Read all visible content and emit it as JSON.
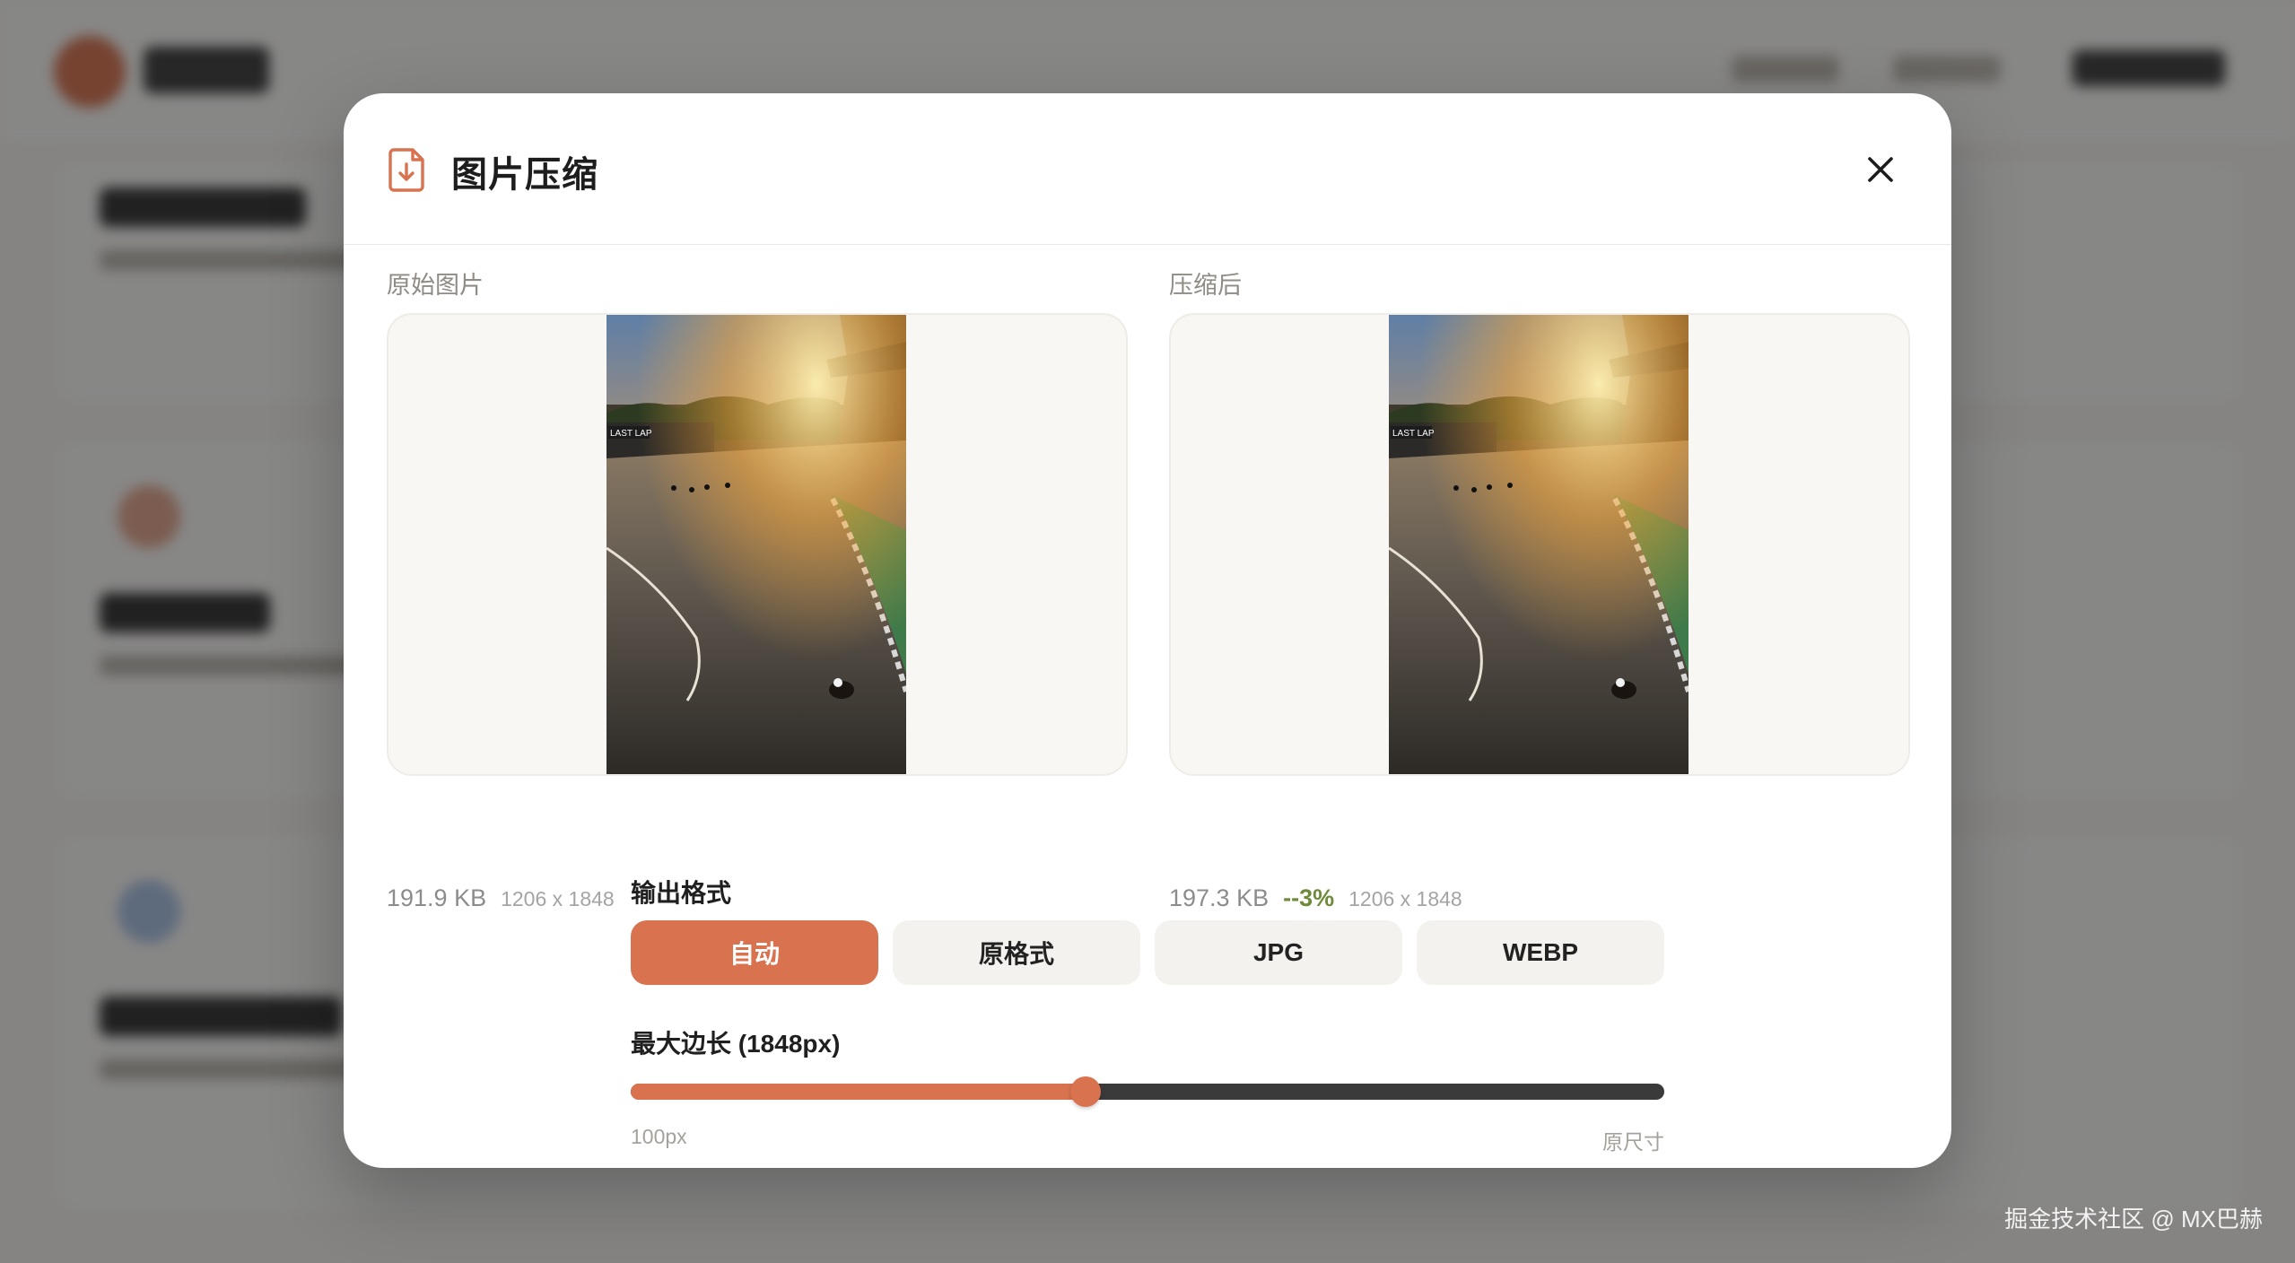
{
  "modal": {
    "title": "图片压缩",
    "original": {
      "label": "原始图片",
      "size": "191.9 KB",
      "dimensions": "1206 x 1848",
      "image_caption": "LAST LAP"
    },
    "compressed": {
      "label": "压缩后",
      "size": "197.3 KB",
      "change": "--3%",
      "dimensions": "1206 x 1848",
      "image_caption": "LAST LAP"
    },
    "output_format": {
      "label": "输出格式",
      "options": [
        "自动",
        "原格式",
        "JPG",
        "WEBP"
      ],
      "selected": "自动"
    },
    "max_edge": {
      "label": "最大边长 (1848px)",
      "min_label": "100px",
      "max_label": "原尺寸",
      "value_fraction": 0.44
    }
  },
  "watermark": "掘金技术社区 @ MX巴赫",
  "colors": {
    "accent": "#d8724f",
    "positive": "#6f8a3a",
    "overlay": "#141414"
  }
}
